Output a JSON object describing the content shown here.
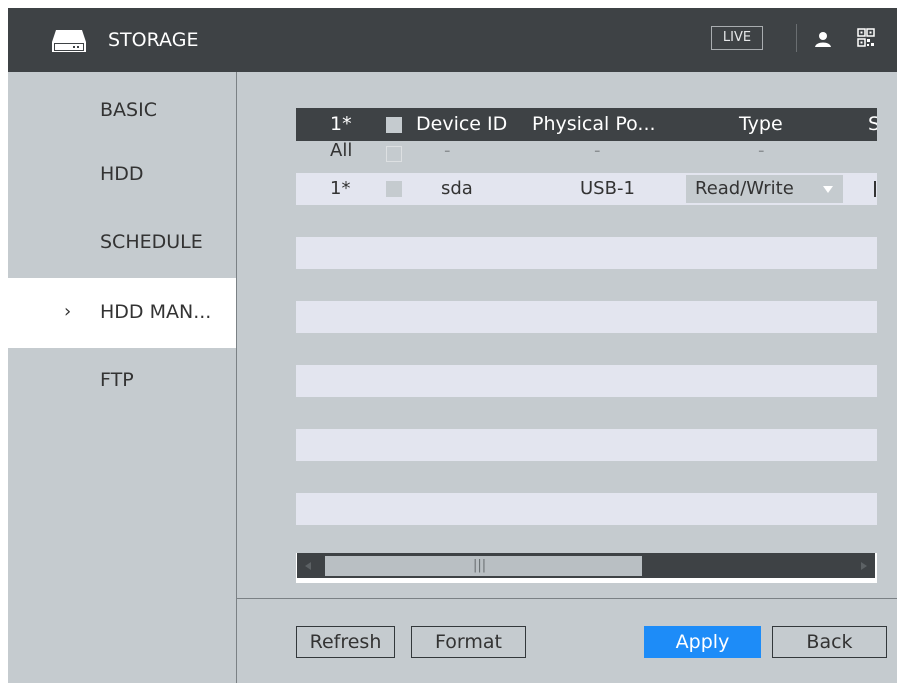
{
  "header": {
    "title": "STORAGE",
    "live_label": "LIVE",
    "colors": {
      "bar": "#3e4245",
      "text": "#ffffff"
    }
  },
  "sidebar": {
    "items": [
      {
        "label": "BASIC",
        "active": false
      },
      {
        "label": "HDD",
        "active": false
      },
      {
        "label": "SCHEDULE",
        "active": false
      },
      {
        "label": "HDD MAN...",
        "active": true
      },
      {
        "label": "FTP",
        "active": false
      }
    ],
    "active_marker": "›"
  },
  "table": {
    "columns": [
      "1*",
      "Device ID",
      "Physical Po...",
      "Type",
      "S"
    ],
    "rows": [
      {
        "group": "All",
        "device_id": "-",
        "physical_port": "-",
        "type": "-"
      },
      {
        "group": "1*",
        "device_id": "sda",
        "physical_port": "USB-1",
        "type": "Read/Write"
      }
    ],
    "type_dropdown_icon": "triangle-down-icon",
    "grip_label": "|||"
  },
  "buttons": {
    "refresh": "Refresh",
    "format": "Format",
    "apply": "Apply",
    "back": "Back"
  },
  "colors": {
    "accent": "#1d8cf8",
    "panel": "#c5cbcf",
    "row_alt": "#e3e5ef",
    "row_grey": "#c5cbcf"
  }
}
